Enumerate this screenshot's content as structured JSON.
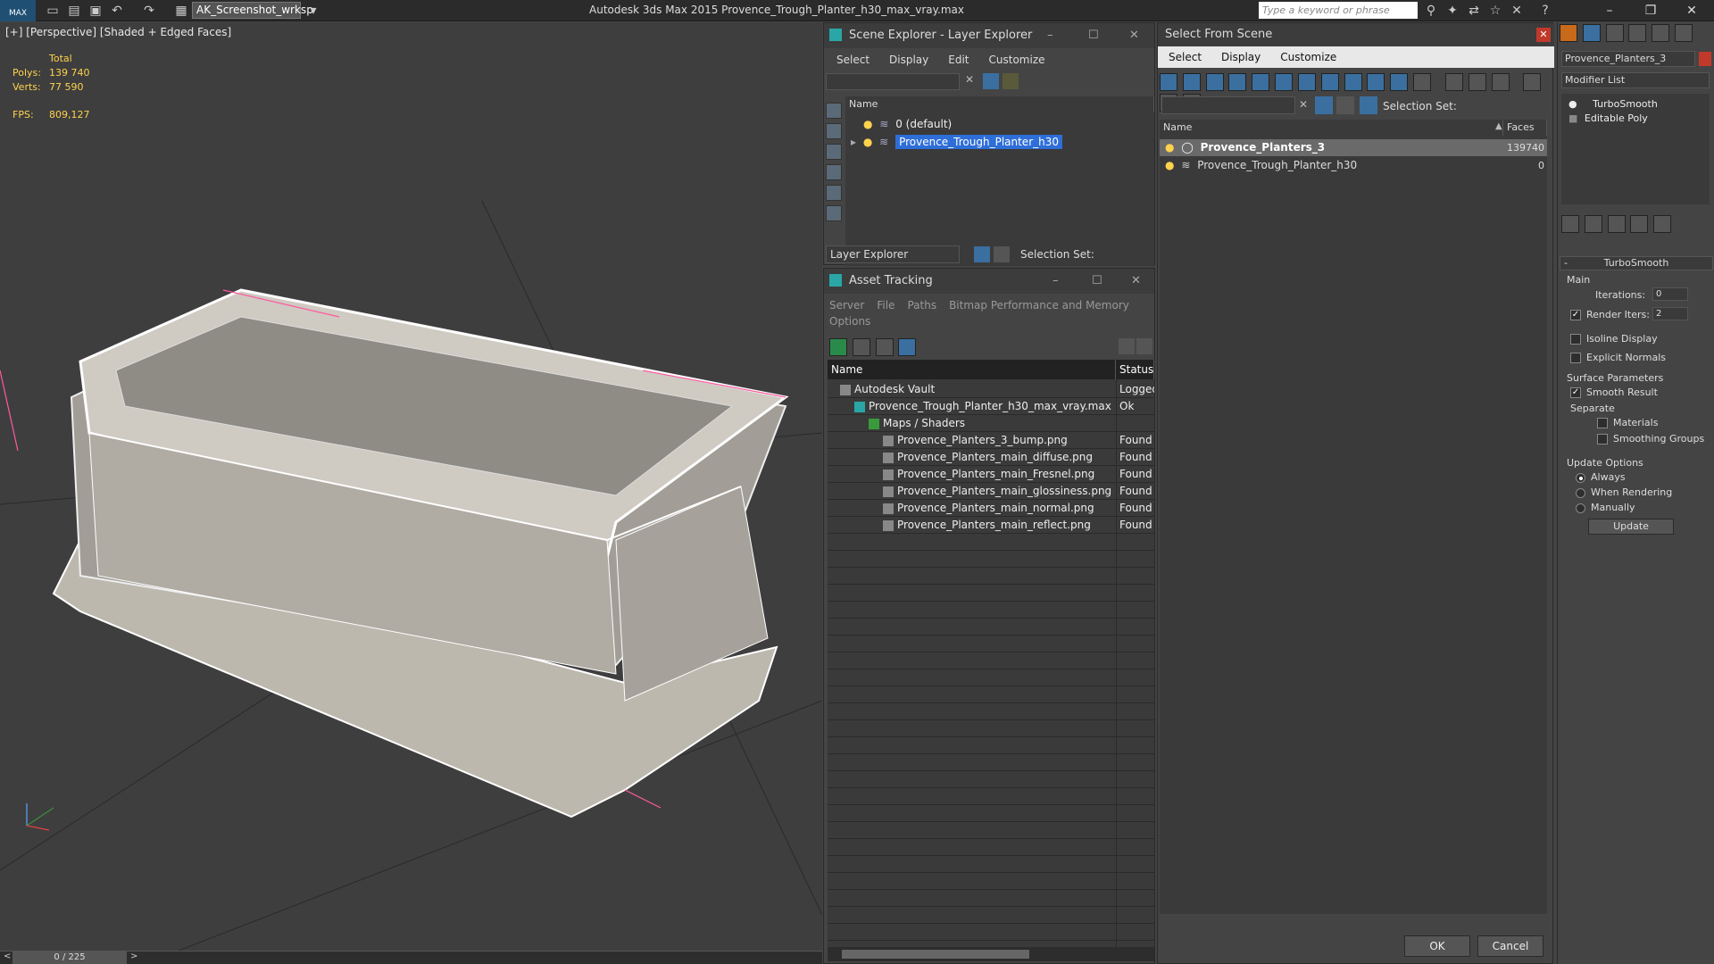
{
  "app": {
    "title": "Autodesk 3ds Max 2015     Provence_Trough_Planter_h30_max_vray.max",
    "workspace": "AK_Screenshot_wrksp",
    "search_placeholder": "Type a keyword or phrase",
    "logo": "MAX"
  },
  "viewport": {
    "label": "[+] [Perspective] [Shaded + Edged Faces]",
    "stats": {
      "total_label": "Total",
      "polys_label": "Polys:",
      "polys": "139 740",
      "verts_label": "Verts:",
      "verts": "77 590",
      "fps_label": "FPS:",
      "fps": "809,127"
    }
  },
  "timeline": {
    "frame": "0 / 225",
    "prev": "<",
    "next": ">"
  },
  "scene_explorer": {
    "title": "Scene Explorer - Layer Explorer",
    "menu": [
      "Select",
      "Display",
      "Edit",
      "Customize"
    ],
    "column": "Name",
    "rows": [
      {
        "name": "0 (default)"
      },
      {
        "name": "Provence_Trough_Planter_h30"
      }
    ],
    "footer_dropdown": "Layer Explorer",
    "selection_set_label": "Selection Set:"
  },
  "asset_tracking": {
    "title": "Asset Tracking",
    "menu_row1": [
      "Server",
      "File",
      "Paths",
      "Bitmap Performance and Memory"
    ],
    "menu_row2": [
      "Options"
    ],
    "columns": [
      "Name",
      "Status"
    ],
    "rows": [
      {
        "name": "Autodesk Vault",
        "status": "Logged",
        "indent": 0
      },
      {
        "name": "Provence_Trough_Planter_h30_max_vray.max",
        "status": "Ok",
        "indent": 1
      },
      {
        "name": "Maps / Shaders",
        "status": "",
        "indent": 2
      },
      {
        "name": "Provence_Planters_3_bump.png",
        "status": "Found",
        "indent": 3
      },
      {
        "name": "Provence_Planters_main_diffuse.png",
        "status": "Found",
        "indent": 3
      },
      {
        "name": "Provence_Planters_main_Fresnel.png",
        "status": "Found",
        "indent": 3
      },
      {
        "name": "Provence_Planters_main_glossiness.png",
        "status": "Found",
        "indent": 3
      },
      {
        "name": "Provence_Planters_main_normal.png",
        "status": "Found",
        "indent": 3
      },
      {
        "name": "Provence_Planters_main_reflect.png",
        "status": "Found",
        "indent": 3
      }
    ]
  },
  "select_from_scene": {
    "title": "Select From Scene",
    "menu": [
      "Select",
      "Display",
      "Customize"
    ],
    "selection_set_label": "Selection Set:",
    "columns": [
      "Name",
      "Faces"
    ],
    "rows": [
      {
        "name": "Provence_Planters_3",
        "faces": "139740"
      },
      {
        "name": "Provence_Trough_Planter_h30",
        "faces": "0"
      }
    ],
    "ok": "OK",
    "cancel": "Cancel"
  },
  "command_panel": {
    "object_name": "Provence_Planters_3",
    "modifier_list": "Modifier List",
    "stack": [
      "TurboSmooth",
      "Editable Poly"
    ],
    "rollout_title": "TurboSmooth",
    "main_label": "Main",
    "iterations_label": "Iterations:",
    "iterations": "0",
    "render_iters_label": "Render Iters:",
    "render_iters": "2",
    "isoline": "Isoline Display",
    "explicit_normals": "Explicit Normals",
    "surface_params": "Surface Parameters",
    "smooth_result": "Smooth Result",
    "separate": "Separate",
    "materials": "Materials",
    "smoothing_groups": "Smoothing Groups",
    "update_options": "Update Options",
    "always": "Always",
    "when_rendering": "When Rendering",
    "manually": "Manually",
    "update": "Update",
    "collapse": "-"
  },
  "colors": {
    "accent": "#2e6ed8",
    "selected_row": "#2e6ed8",
    "stat_text": "#ffd24d",
    "selection_pink": "#ff5aa0"
  }
}
